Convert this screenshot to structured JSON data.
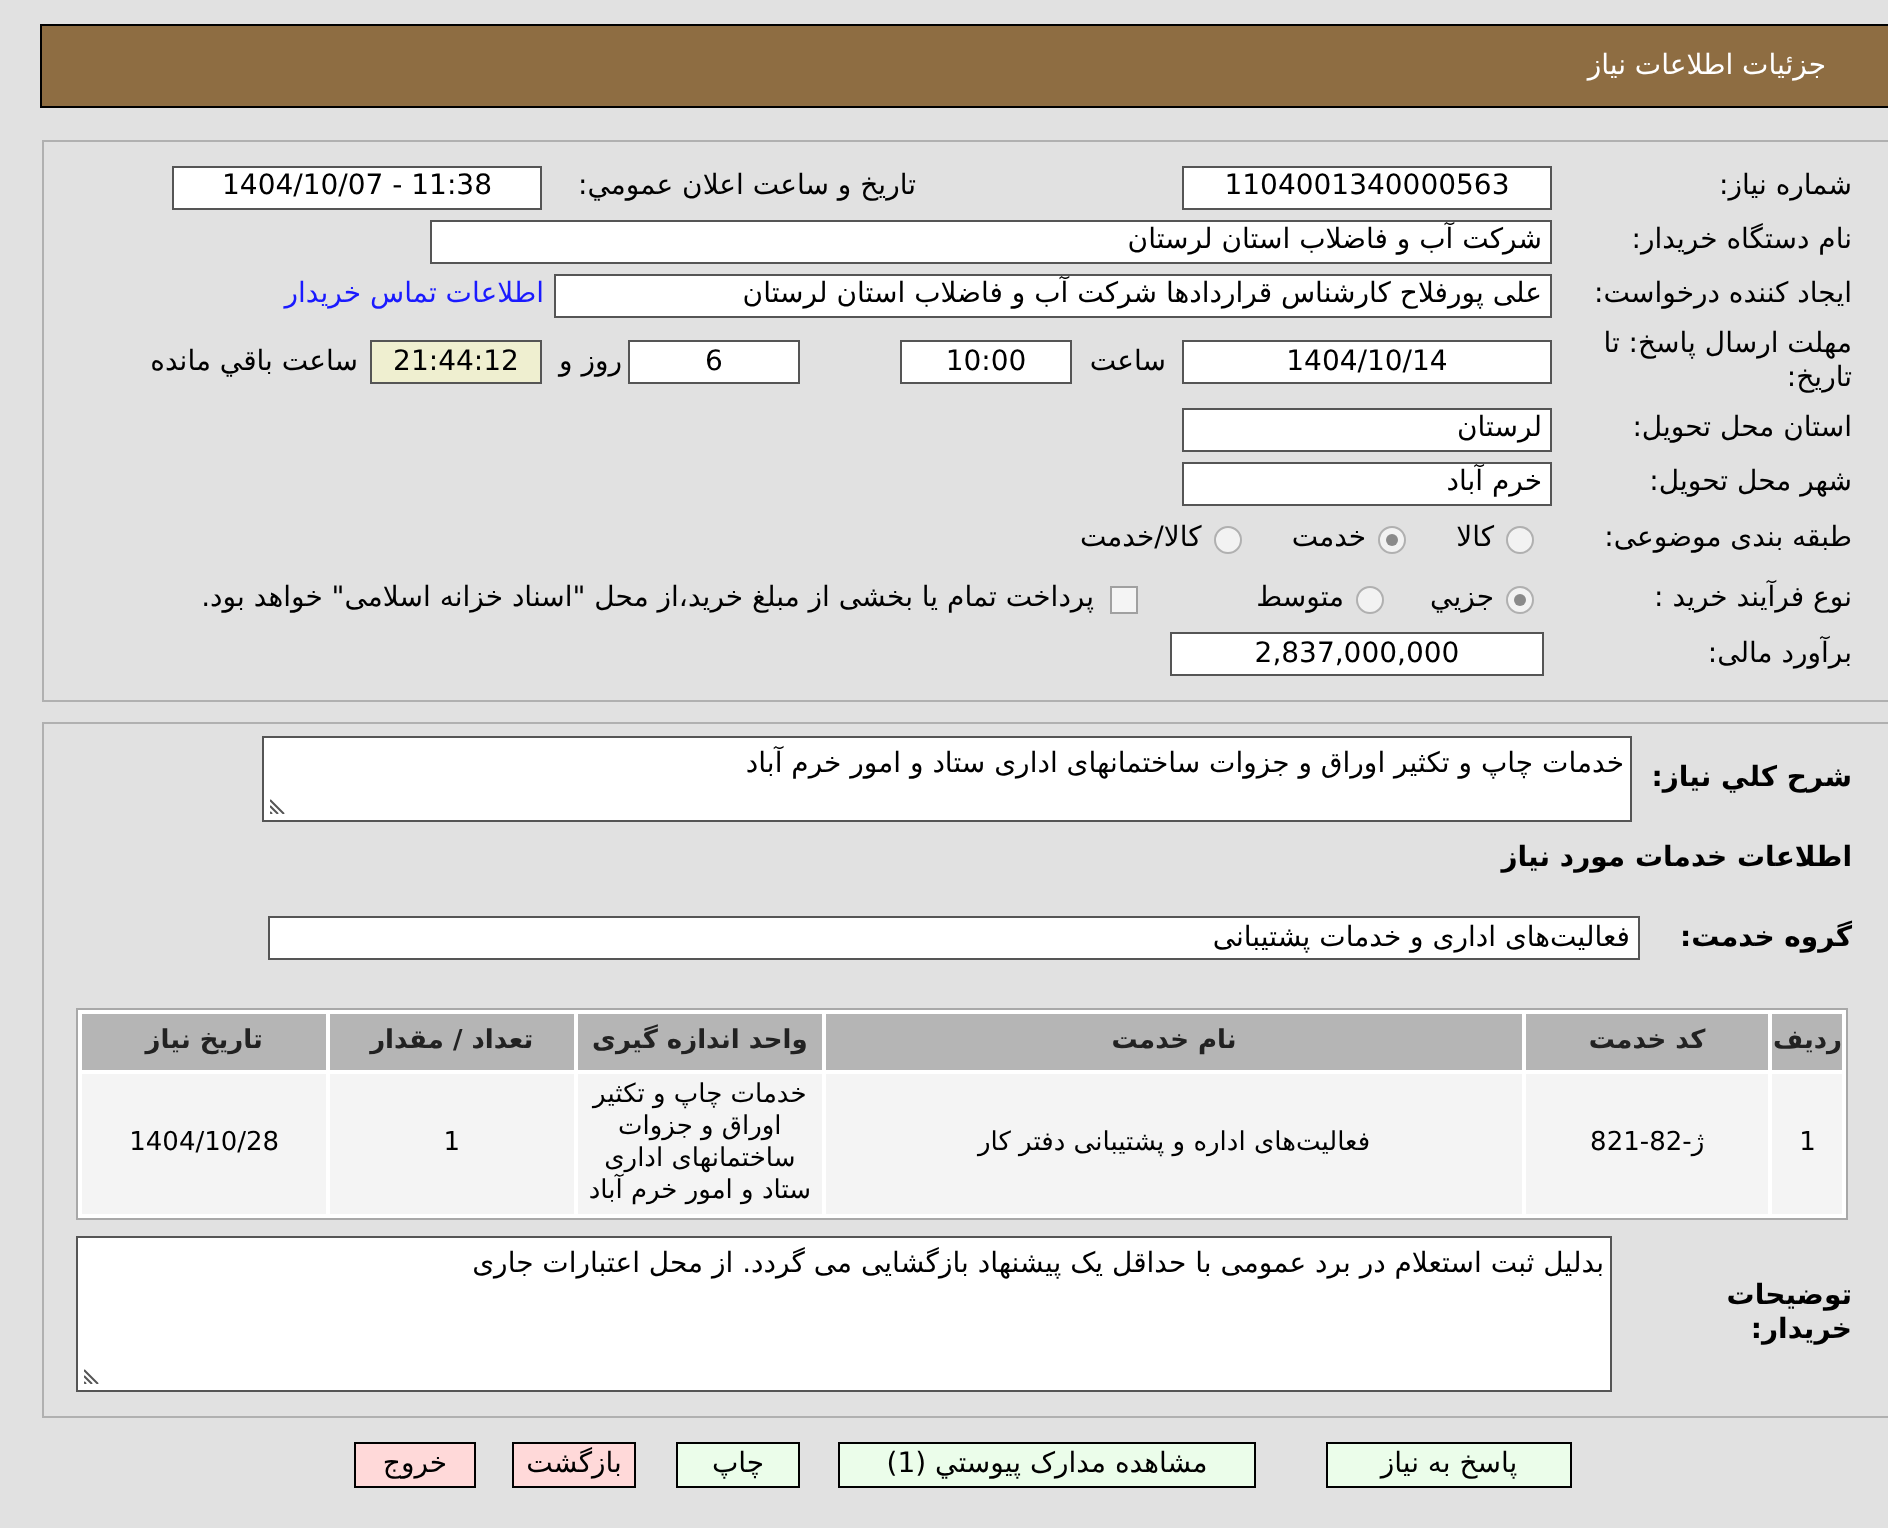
{
  "header": {
    "title": "جزئیات اطلاعات نیاز"
  },
  "need_info": {
    "need_number": {
      "label": "شماره نیاز:",
      "value": "1104001340000563"
    },
    "announce": {
      "label": "تاریخ و ساعت اعلان عمومي:",
      "value": "1404/10/07 - 11:38"
    },
    "buyer_org": {
      "label": "نام دستگاه خريدار:",
      "value": "شرکت آب و فاضلاب استان لرستان"
    },
    "requester": {
      "label": "ایجاد کننده درخواست:",
      "value": "علی پورفلاح کارشناس قراردادها شرکت آب و فاضلاب استان لرستان",
      "link": "اطلاعات تماس خريدار"
    },
    "deadline": {
      "label": "مهلت ارسال پاسخ: تا تاریخ:",
      "date": "1404/10/14",
      "time_label": "ساعت",
      "time": "10:00",
      "days": "6",
      "days_label": "روز و",
      "remaining": "21:44:12",
      "remaining_label": "ساعت باقي مانده"
    },
    "province": {
      "label": "استان محل تحویل:",
      "value": "لرستان"
    },
    "city": {
      "label": "شهر محل تحویل:",
      "value": "خرم آباد"
    },
    "category": {
      "label": "طبقه بندی موضوعی:",
      "options": [
        {
          "label": "کالا",
          "selected": false
        },
        {
          "label": "خدمت",
          "selected": true
        },
        {
          "label": "کالا/خدمت",
          "selected": false
        }
      ]
    },
    "purchase_type": {
      "label": "نوع فرآیند خرید :",
      "options": [
        {
          "label": "جزيي",
          "selected": true
        },
        {
          "label": "متوسط",
          "selected": false
        }
      ],
      "treasury": {
        "label": "پرداخت تمام یا بخشی از مبلغ خرید،از محل \"اسناد خزانه اسلامی\" خواهد بود.",
        "checked": false
      }
    },
    "budget": {
      "label": "برآورد مالی:",
      "value": "2,837,000,000"
    }
  },
  "services": {
    "summary": {
      "label": "شرح کلي نیاز:",
      "value": "خدمات چاپ و تکثیر اوراق و جزوات ساختمانهای اداری ستاد و امور خرم آباد"
    },
    "section_title": "اطلاعات خدمات مورد نیاز",
    "group": {
      "label": "گروه خدمت:",
      "value": "فعالیت‌های اداری و خدمات پشتیبانی"
    },
    "table": {
      "columns": [
        "ردیف",
        "کد خدمت",
        "نام خدمت",
        "واحد اندازه گیری",
        "تعداد / مقدار",
        "تاریخ نیاز"
      ],
      "rows": [
        [
          "1",
          "ژ-82-821",
          "فعالیت‌های اداره و پشتیبانی دفتر کار",
          "خدمات چاپ و تکثیر اوراق و جزوات ساختمانهای اداری ستاد و امور خرم آباد",
          "1",
          "1404/10/28"
        ]
      ]
    },
    "buyer_notes": {
      "label": "توضیحات خریدار:",
      "value": "بدلیل ثبت استعلام در برد عمومی با حداقل یک پیشنهاد بازگشایی می گردد. از محل اعتبارات جاری"
    }
  },
  "buttons": [
    {
      "label": "پاسخ به نیاز",
      "kind": "primary"
    },
    {
      "label": "مشاهده مدارک پیوستي (1)",
      "kind": "primary"
    },
    {
      "label": "چاپ",
      "kind": "primary"
    },
    {
      "label": "بازگشت",
      "kind": "danger"
    },
    {
      "label": "خروج",
      "kind": "danger"
    }
  ]
}
